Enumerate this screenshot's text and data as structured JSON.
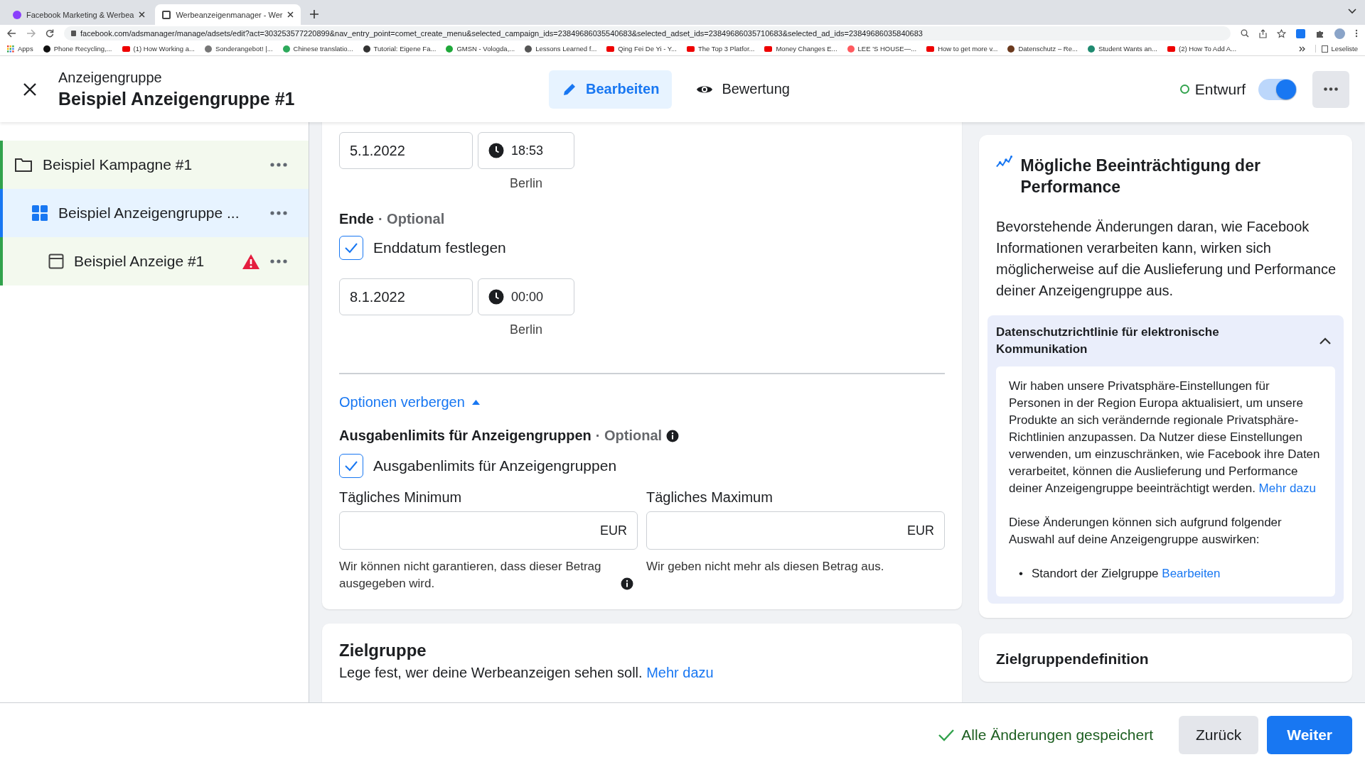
{
  "browser": {
    "tabs": [
      {
        "title": "Facebook Marketing & Werbea",
        "selected": false
      },
      {
        "title": "Werbeanzeigenmanager - Wer",
        "selected": true
      }
    ],
    "url": "facebook.com/adsmanager/manage/adsets/edit?act=303253577220899&nav_entry_point=comet_create_menu&selected_campaign_ids=23849686035540683&selected_adset_ids=23849686035710683&selected_ad_ids=23849686035840683",
    "bookmarks": [
      {
        "label": "Apps",
        "kind": "apps"
      },
      {
        "label": "Phone Recycling,...",
        "kind": "site",
        "color": "#111111"
      },
      {
        "label": "(1) How Working a...",
        "kind": "youtube"
      },
      {
        "label": "Sonderangebot! |...",
        "kind": "site",
        "color": "#777777"
      },
      {
        "label": "Chinese translatio...",
        "kind": "site",
        "color": "#2eaa5c"
      },
      {
        "label": "Tutorial: Eigene Fa...",
        "kind": "site",
        "color": "#333333"
      },
      {
        "label": "GMSN - Vologda,...",
        "kind": "site",
        "color": "#1fa83a"
      },
      {
        "label": "Lessons Learned f...",
        "kind": "site",
        "color": "#555555"
      },
      {
        "label": "Qing Fei De Yi - Y...",
        "kind": "youtube"
      },
      {
        "label": "The Top 3 Platfor...",
        "kind": "youtube"
      },
      {
        "label": "Money Changes E...",
        "kind": "youtube"
      },
      {
        "label": "LEE 'S HOUSE—...",
        "kind": "site",
        "color": "#ff5a5f"
      },
      {
        "label": "How to get more v...",
        "kind": "youtube"
      },
      {
        "label": "Datenschutz – Re...",
        "kind": "site",
        "color": "#6b3a1e"
      },
      {
        "label": "Student Wants an...",
        "kind": "site",
        "color": "#1f8a70"
      },
      {
        "label": "(2) How To Add A...",
        "kind": "youtube"
      }
    ],
    "reading_list": "Leseliste"
  },
  "header": {
    "eyebrow": "Anzeigengruppe",
    "title": "Beispiel Anzeigengruppe #1",
    "tabs": [
      {
        "label": "Bearbeiten",
        "selected": true
      },
      {
        "label": "Bewertung",
        "selected": false
      }
    ],
    "status": "Entwurf",
    "toggle_on": true
  },
  "tree": [
    {
      "label": "Beispiel Kampagne #1",
      "kind": "campaign",
      "selected": false,
      "children": [
        {
          "label": "Beispiel Anzeigengruppe ...",
          "kind": "adset",
          "selected": true,
          "children": [
            {
              "label": "Beispiel Anzeige #1",
              "kind": "ad",
              "selected": false,
              "warning": true
            }
          ]
        }
      ]
    }
  ],
  "schedule": {
    "start": {
      "date": "5.1.2022",
      "time": "18:53",
      "timezone": "Berlin"
    },
    "end": {
      "label": "Ende",
      "optional": "· Optional",
      "checkbox": {
        "label": "Enddatum festlegen",
        "checked": true
      },
      "date": "8.1.2022",
      "time": "00:00",
      "timezone": "Berlin"
    }
  },
  "options": {
    "label": "Optionen verbergen",
    "expanded": true
  },
  "spend_limits": {
    "title": "Ausgabenlimits für Anzeigengruppen",
    "optional": "· Optional",
    "checkbox": {
      "label": "Ausgabenlimits für Anzeigengruppen",
      "checked": true
    },
    "fields": [
      {
        "label": "Tägliches Minimum",
        "currency": "EUR",
        "help": "Wir können nicht garantieren, dass dieser Betrag ausgegeben wird.",
        "info": true
      },
      {
        "label": "Tägliches Maximum",
        "currency": "EUR",
        "help": "Wir geben nicht mehr als diesen Betrag aus.",
        "info": false
      }
    ]
  },
  "audience": {
    "title": "Zielgruppe",
    "text": "Lege fest, wer deine Werbeanzeigen sehen soll.",
    "link": "Mehr dazu"
  },
  "side_panel": {
    "title": "Mögliche Beeinträchtigung der Performance",
    "body": "Bevorstehende Änderungen daran, wie Facebook Informationen verarbeiten kann, wirken sich möglicherweise auf die Auslieferung und Performance deiner Anzeigengruppe aus.",
    "accordion": {
      "title": "Datenschutzrichtlinie für elektronische Kommunikation",
      "expanded": true,
      "text": "Wir haben unsere Privatsphäre-Einstellungen für Personen in der Region Europa aktualisiert, um unsere Produkte an sich verändernde regionale Privatsphäre-Richtlinien anzupassen. Da Nutzer diese Einstellungen verwenden, um einzuschränken, wie Facebook ihre Daten verarbeitet, können die Auslieferung und Performance deiner Anzeigengruppe beeinträchtigt werden.",
      "link": "Mehr dazu",
      "text_2": "Diese Änderungen können sich aufgrund folgender Auswahl auf deine Anzeigengruppe auswirken:",
      "bullets": [
        {
          "marker": "•",
          "text": "Standort der Zielgruppe",
          "link": "Bearbeiten"
        }
      ]
    },
    "next_card_title": "Zielgruppendefinition"
  },
  "footer": {
    "saved": "Alle Änderungen gespeichert",
    "back": "Zurück",
    "next": "Weiter"
  }
}
